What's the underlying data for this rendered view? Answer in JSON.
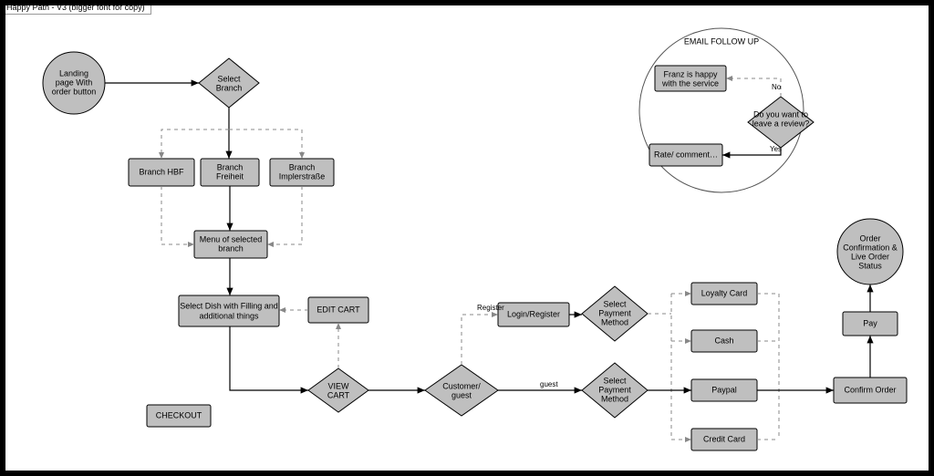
{
  "tab_label": "Happy Path - V3 (bigger font for copy)",
  "nodes": {
    "landing": "Landing page With order button",
    "select_branch": "Select Branch",
    "branch_hbf": "Branch HBF",
    "branch_freiheit": "Branch Freiheit",
    "branch_impler": "Branch Implerstraße",
    "menu": "Menu of selected branch",
    "select_dish": "Select Dish with Filling and additional things",
    "edit_cart": "EDIT CART",
    "view_cart": "VIEW CART",
    "checkout": "CHECKOUT",
    "customer_guest": "Customer/ guest",
    "login_register": "Login/Register",
    "select_pay_top": "Select Payment Method",
    "select_pay_bot": "Select Payment Method",
    "loyalty": "Loyalty Card",
    "cash": "Cash",
    "paypal": "Paypal",
    "credit": "Credit Card",
    "confirm_order": "Confirm Order",
    "pay": "Pay",
    "order_conf": "Order Confirmation & Live Order Status"
  },
  "edges": {
    "register": "Register",
    "guest": "guest"
  },
  "followup": {
    "title": "EMAIL FOLLOW UP",
    "happy": "Franz is happy with the service",
    "review": "Do you want to leave a review?",
    "rate": "Rate/ comment…",
    "yes": "Yes",
    "no": "No"
  }
}
